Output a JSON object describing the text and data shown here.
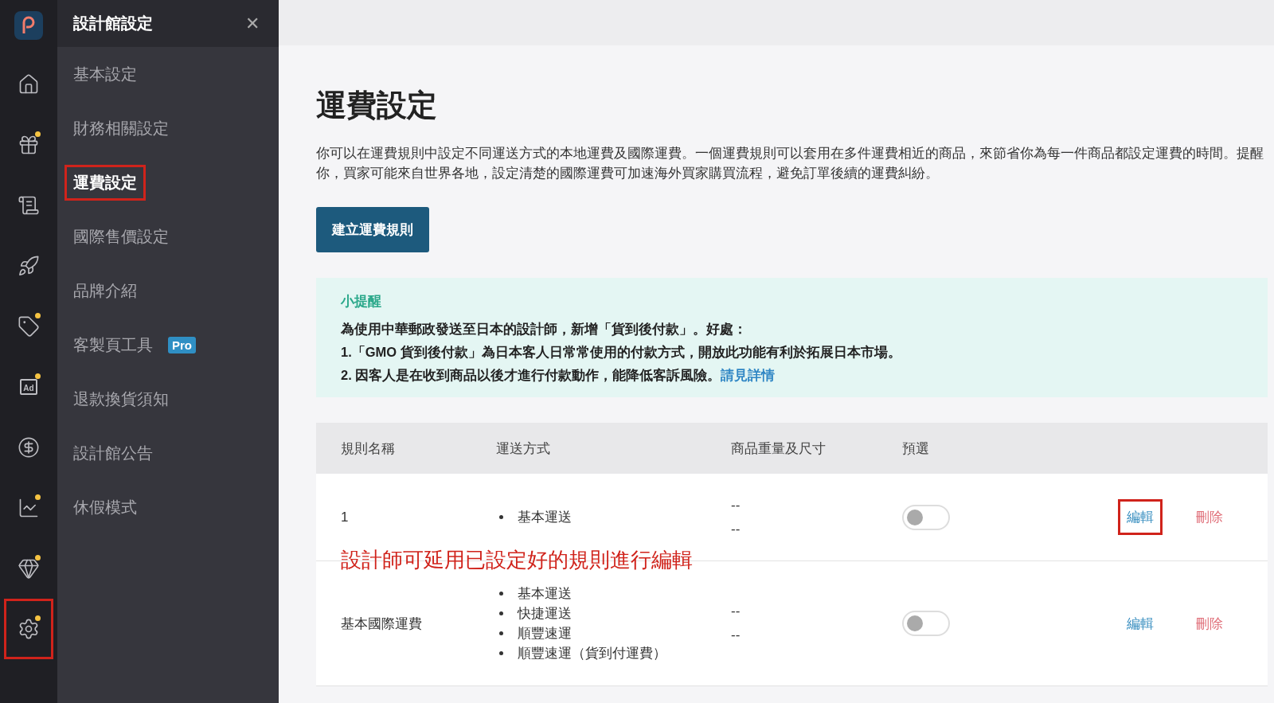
{
  "rail": [
    {
      "dot": false,
      "annotated": false
    },
    {
      "dot": true,
      "annotated": false
    },
    {
      "dot": false,
      "annotated": false
    },
    {
      "dot": false,
      "annotated": false
    },
    {
      "dot": true,
      "annotated": false
    },
    {
      "dot": true,
      "annotated": false
    },
    {
      "dot": false,
      "annotated": false
    },
    {
      "dot": true,
      "annotated": false
    },
    {
      "dot": true,
      "annotated": false
    },
    {
      "dot": true,
      "annotated": true
    }
  ],
  "ad_icon_label": "Ad",
  "submenu": {
    "title": "設計館設定",
    "close": "✕",
    "items": [
      {
        "label": "基本設定",
        "selected": false,
        "annotated": false
      },
      {
        "label": "財務相關設定",
        "selected": false,
        "annotated": false
      },
      {
        "label": "運費設定",
        "selected": true,
        "annotated": true
      },
      {
        "label": "國際售價設定",
        "selected": false,
        "annotated": false
      },
      {
        "label": "品牌介紹",
        "selected": false,
        "annotated": false
      },
      {
        "label": "客製頁工具",
        "badge": "Pro",
        "selected": false,
        "annotated": false
      },
      {
        "label": "退款換貨須知",
        "selected": false,
        "annotated": false
      },
      {
        "label": "設計館公告",
        "selected": false,
        "annotated": false
      },
      {
        "label": "休假模式",
        "selected": false,
        "annotated": false
      }
    ]
  },
  "page": {
    "title": "運費設定",
    "description": "你可以在運費規則中設定不同運送方式的本地運費及國際運費。一個運費規則可以套用在多件運費相近的商品，來節省你為每一件商品都設定運費的時間。提醒你，買家可能來自世界各地，設定清楚的國際運費可加速海外買家購買流程，避免訂單後續的運費糾紛。",
    "create_button": "建立運費規則"
  },
  "notice": {
    "title": "小提醒",
    "lines": [
      "為使用中華郵政發送至日本的設計師，新增「貨到後付款」。好處：",
      "1.「GMO 貨到後付款」為日本客人日常常使用的付款方式，開放此功能有利於拓展日本市場。",
      "2. 因客人是在收到商品以後才進行付款動作，能降低客訴風險。"
    ],
    "link": "請見詳情"
  },
  "table": {
    "columns": [
      "規則名稱",
      "運送方式",
      "商品重量及尺寸",
      "預選"
    ],
    "rows": [
      {
        "name": "1",
        "methods": [
          "基本運送"
        ],
        "sizes": [
          "--",
          "--"
        ],
        "on": false,
        "edit": "編輯",
        "delete": "刪除",
        "edit_annotated": true
      },
      {
        "name": "基本國際運費",
        "methods": [
          "基本運送",
          "快捷運送",
          "順豐速運",
          "順豐速運（貨到付運費）"
        ],
        "sizes": [
          "--",
          "--"
        ],
        "on": false,
        "edit": "編輯",
        "delete": "刪除",
        "edit_annotated": false
      }
    ]
  },
  "annotation": "設計師可延用已設定好的規則進行編輯"
}
